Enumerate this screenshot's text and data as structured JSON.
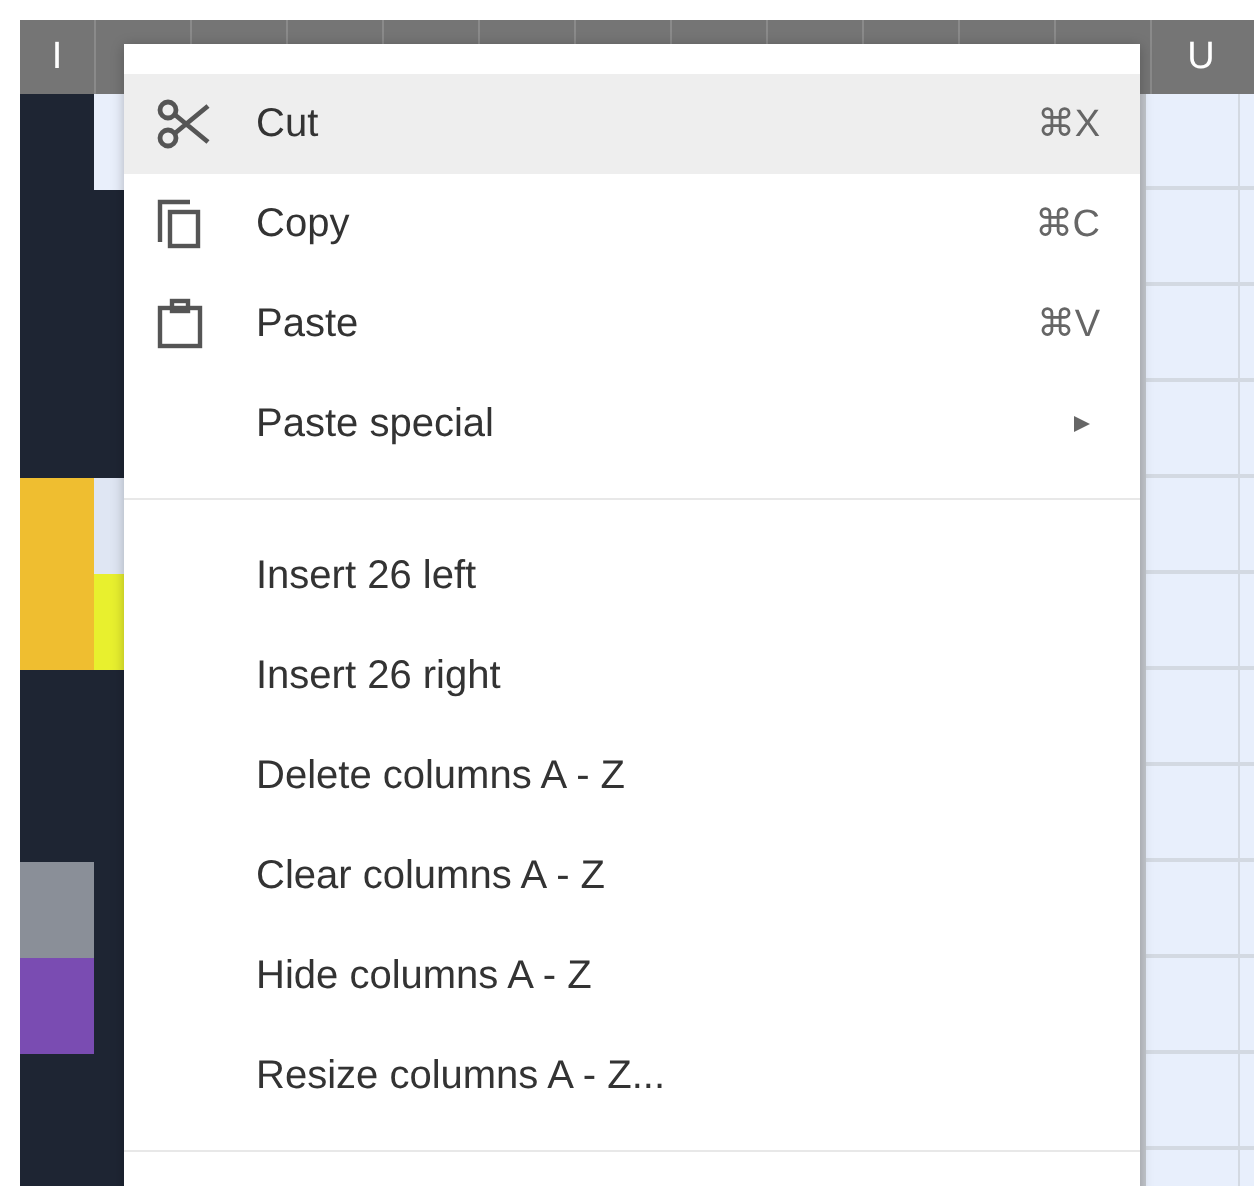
{
  "sheet": {
    "column_headers": [
      "I",
      "U"
    ],
    "column_i_cells": [
      {
        "color": "#1e2533"
      },
      {
        "color": "#1e2533"
      },
      {
        "color": "#1e2533"
      },
      {
        "color": "#1e2533"
      },
      {
        "color": "#efbe30"
      },
      {
        "color": "#efbe30"
      },
      {
        "color": "#1e2533"
      },
      {
        "color": "#1e2533"
      },
      {
        "color": "#8a8f98"
      },
      {
        "color": "#7a4cb2"
      },
      {
        "color": "#1e2533"
      },
      {
        "color": "#1e2533"
      }
    ],
    "column_j_cells": [
      {
        "color": "#e9effb"
      },
      {
        "color": "#1e2533"
      },
      {
        "color": "#1e2533"
      },
      {
        "color": "#1e2533"
      },
      {
        "color": "#dfe6f3"
      },
      {
        "color": "#e8f02e"
      },
      {
        "color": "#1e2533"
      },
      {
        "color": "#1e2533"
      },
      {
        "color": "#1e2533"
      },
      {
        "color": "#1e2533"
      },
      {
        "color": "#1e2533"
      },
      {
        "color": "#1e2533"
      }
    ]
  },
  "context_menu": {
    "sections": [
      {
        "items": [
          {
            "label": "Cut",
            "shortcut": "⌘X",
            "submenu": false,
            "selected": true
          },
          {
            "label": "Copy",
            "shortcut": "⌘C",
            "submenu": false,
            "selected": false
          },
          {
            "label": "Paste",
            "shortcut": "⌘V",
            "submenu": false,
            "selected": false
          },
          {
            "label": "Paste special",
            "submenu": true,
            "selected": false
          }
        ]
      },
      {
        "items": [
          {
            "label": "Insert 26 left",
            "submenu": false,
            "selected": false
          },
          {
            "label": "Insert 26 right",
            "submenu": false,
            "selected": false
          },
          {
            "label": "Delete columns A - Z",
            "submenu": false,
            "selected": false
          },
          {
            "label": "Clear columns A - Z",
            "submenu": false,
            "selected": false
          },
          {
            "label": "Hide columns A - Z",
            "submenu": false,
            "selected": false
          },
          {
            "label": "Resize columns A - Z...",
            "submenu": false,
            "selected": false
          }
        ]
      }
    ]
  }
}
